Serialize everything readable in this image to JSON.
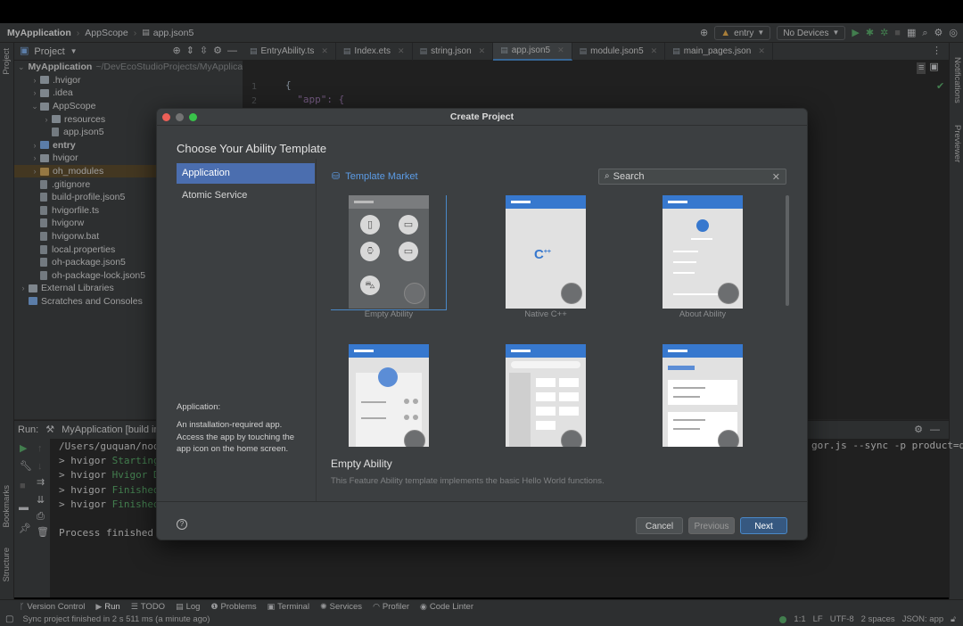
{
  "breadcrumb": [
    "MyApplication",
    "AppScope",
    "app.json5"
  ],
  "toolbar": {
    "run_config": "entry",
    "device": "No Devices"
  },
  "project_panel": {
    "title": "Project",
    "tree": [
      {
        "label": "MyApplication",
        "suffix": "~/DevEcoStudioProjects/MyApplicat",
        "indent": 0,
        "arrow": "⌄",
        "kind": "folder-blue",
        "bold": true
      },
      {
        "label": ".hvigor",
        "indent": 1,
        "arrow": "›",
        "kind": "folder"
      },
      {
        "label": ".idea",
        "indent": 1,
        "arrow": "›",
        "kind": "folder"
      },
      {
        "label": "AppScope",
        "indent": 1,
        "arrow": "⌄",
        "kind": "folder"
      },
      {
        "label": "resources",
        "indent": 2,
        "arrow": "›",
        "kind": "folder"
      },
      {
        "label": "app.json5",
        "indent": 2,
        "arrow": "",
        "kind": "file"
      },
      {
        "label": "entry",
        "indent": 1,
        "arrow": "›",
        "kind": "folder-blue",
        "bold": true
      },
      {
        "label": "hvigor",
        "indent": 1,
        "arrow": "›",
        "kind": "folder"
      },
      {
        "label": "oh_modules",
        "indent": 1,
        "arrow": "›",
        "kind": "folder-orange",
        "selected": true
      },
      {
        "label": ".gitignore",
        "indent": 1,
        "arrow": "",
        "kind": "file"
      },
      {
        "label": "build-profile.json5",
        "indent": 1,
        "arrow": "",
        "kind": "file"
      },
      {
        "label": "hvigorfile.ts",
        "indent": 1,
        "arrow": "",
        "kind": "file"
      },
      {
        "label": "hvigorw",
        "indent": 1,
        "arrow": "",
        "kind": "file"
      },
      {
        "label": "hvigorw.bat",
        "indent": 1,
        "arrow": "",
        "kind": "file"
      },
      {
        "label": "local.properties",
        "indent": 1,
        "arrow": "",
        "kind": "file"
      },
      {
        "label": "oh-package.json5",
        "indent": 1,
        "arrow": "",
        "kind": "file"
      },
      {
        "label": "oh-package-lock.json5",
        "indent": 1,
        "arrow": "",
        "kind": "file"
      },
      {
        "label": "External Libraries",
        "indent": 0,
        "arrow": "›",
        "kind": "lib"
      },
      {
        "label": "Scratches and Consoles",
        "indent": 0,
        "arrow": "",
        "kind": "scratch"
      }
    ]
  },
  "editor_tabs": [
    {
      "label": "EntryAbility.ts",
      "active": false
    },
    {
      "label": "Index.ets",
      "active": false
    },
    {
      "label": "string.json",
      "active": false
    },
    {
      "label": "app.json5",
      "active": true
    },
    {
      "label": "module.json5",
      "active": false
    },
    {
      "label": "main_pages.json",
      "active": false
    }
  ],
  "editor": {
    "line_numbers": [
      "1",
      "2"
    ],
    "lines": [
      "{",
      "  \"app\": {"
    ]
  },
  "run_panel": {
    "label": "Run:",
    "tab": "MyApplication [build init]",
    "lines": [
      {
        "prefix": "/Users/guquan/node",
        "rest": ""
      },
      {
        "prefix": "> hvigor ",
        "rest": "Starting"
      },
      {
        "prefix": "> hvigor ",
        "rest": "Hvigor Da"
      },
      {
        "prefix": "> hvigor ",
        "rest": "Finished"
      },
      {
        "prefix": "> hvigor ",
        "rest": "Finished"
      }
    ],
    "finished": "Process finished w",
    "right_text": "gor.js --sync -p product=de"
  },
  "left_strip": {
    "project": "Project",
    "bookmarks": "Bookmarks",
    "structure": "Structure"
  },
  "right_strip": {
    "notifications": "Notifications",
    "previewer": "Previewer"
  },
  "bottom_tabs": [
    "Version Control",
    "Run",
    "TODO",
    "Log",
    "Problems",
    "Terminal",
    "Services",
    "Profiler",
    "Code Linter"
  ],
  "status": {
    "message": "Sync project finished in 2 s 511 ms (a minute ago)",
    "position": "1:1",
    "line_sep": "LF",
    "encoding": "UTF-8",
    "indent": "2 spaces",
    "file_type": "JSON: app"
  },
  "dialog": {
    "title": "Create Project",
    "heading": "Choose Your Ability Template",
    "nav": [
      {
        "label": "Application",
        "selected": true
      },
      {
        "label": "Atomic Service",
        "selected": false
      }
    ],
    "description_label": "Application:",
    "description": "An installation-required app. Access the app by touching the app icon on the home screen.",
    "market_label": "Template Market",
    "search_placeholder": "Search",
    "templates": [
      {
        "name": "Empty Ability",
        "selected": true
      },
      {
        "name": "Native C++",
        "selected": false
      },
      {
        "name": "About Ability",
        "selected": false
      },
      {
        "name": "",
        "selected": false
      },
      {
        "name": "",
        "selected": false
      },
      {
        "name": "",
        "selected": false
      }
    ],
    "selected_title": "Empty Ability",
    "selected_desc": "This Feature Ability template implements the basic Hello World functions.",
    "buttons": {
      "cancel": "Cancel",
      "previous": "Previous",
      "next": "Next"
    }
  },
  "colors": {
    "accent": "#4b6eaf",
    "header_blue": "#3778ce",
    "link": "#5c9ce6",
    "green": "#59a869"
  }
}
